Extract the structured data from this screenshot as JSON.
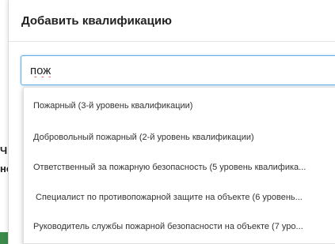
{
  "modal": {
    "title": "Добавить квалификацию"
  },
  "search": {
    "value": "пож"
  },
  "dropdown": {
    "options": [
      "Пожарный (3-й уровень квалификации)",
      "Добровольный пожарный (2-й уровень квалификации)",
      "Ответственный за пожарную безопасность (5 уровень квалифика...",
      "Специалист по противопожарной защите на объекте (6 уровень...",
      "Руководитель службы пожарной безопасности на объекте (7 уро..."
    ]
  },
  "background": {
    "fragment_1": "Ч",
    "fragment_2": "не"
  },
  "colors": {
    "focus_border": "#66afe9",
    "button_green": "#3b8a4a",
    "spellcheck_red": "#e03030"
  }
}
